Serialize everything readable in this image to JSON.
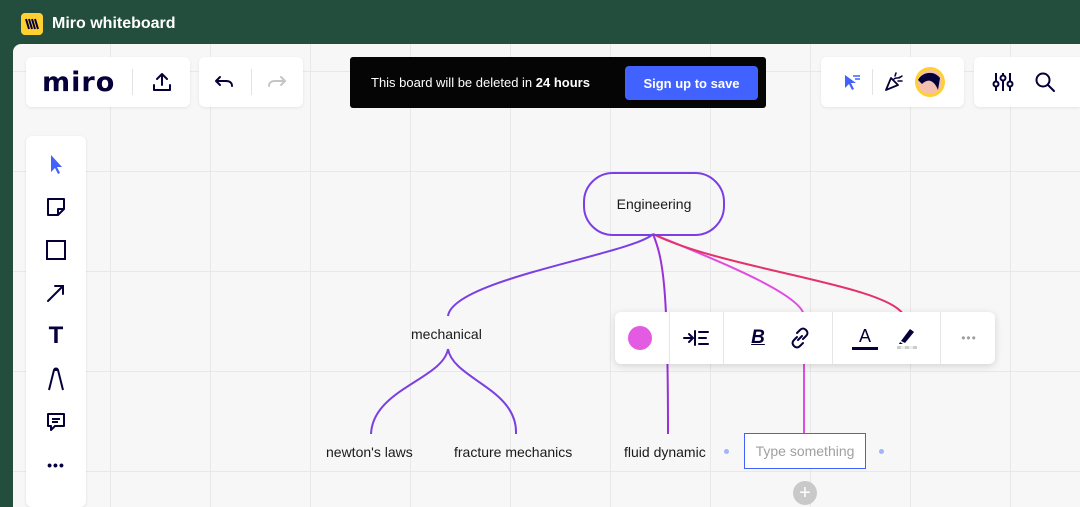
{
  "window": {
    "title": "Miro whiteboard"
  },
  "brand": {
    "wordmark": "miro"
  },
  "topbar": {
    "share_icon": "upload-icon",
    "undo_icon": "undo-icon",
    "redo_icon": "redo-icon"
  },
  "banner": {
    "text_prefix": "This board will be deleted in ",
    "text_bold": "24 hours",
    "cta": "Sign up to save"
  },
  "topright": {
    "icons": [
      "cursor-follow-icon",
      "celebrate-icon",
      "avatar",
      "settings-sliders-icon",
      "search-icon"
    ]
  },
  "left_toolbar": {
    "tools": [
      "select-icon",
      "sticky-note-icon",
      "shape-icon",
      "arrow-icon",
      "text-icon",
      "pen-icon",
      "comment-icon",
      "more-icon"
    ],
    "text_tool_label": "T",
    "more_label": "•••"
  },
  "mindmap": {
    "root": "Engineering",
    "nodes": {
      "mechanical": "mechanical",
      "newtons_laws": "newton's laws",
      "fracture_mechanics": "fracture mechanics",
      "fluid_dynamic": "fluid dynamic"
    },
    "new_node_placeholder": "Type something",
    "colors": {
      "purple": "#7b3fe4",
      "violet": "#9b30d9",
      "magenta": "#e14ce0",
      "red": "#e4336a"
    }
  },
  "context_toolbar": {
    "color_swatch": "#e35ae3",
    "bold_label": "B",
    "text_color_label": "A",
    "more_label": "•••",
    "icons": [
      "color-swatch-icon",
      "align-icon",
      "bold-icon",
      "link-icon",
      "text-color-icon",
      "highlight-icon",
      "more-icon"
    ]
  },
  "add_button": "+"
}
